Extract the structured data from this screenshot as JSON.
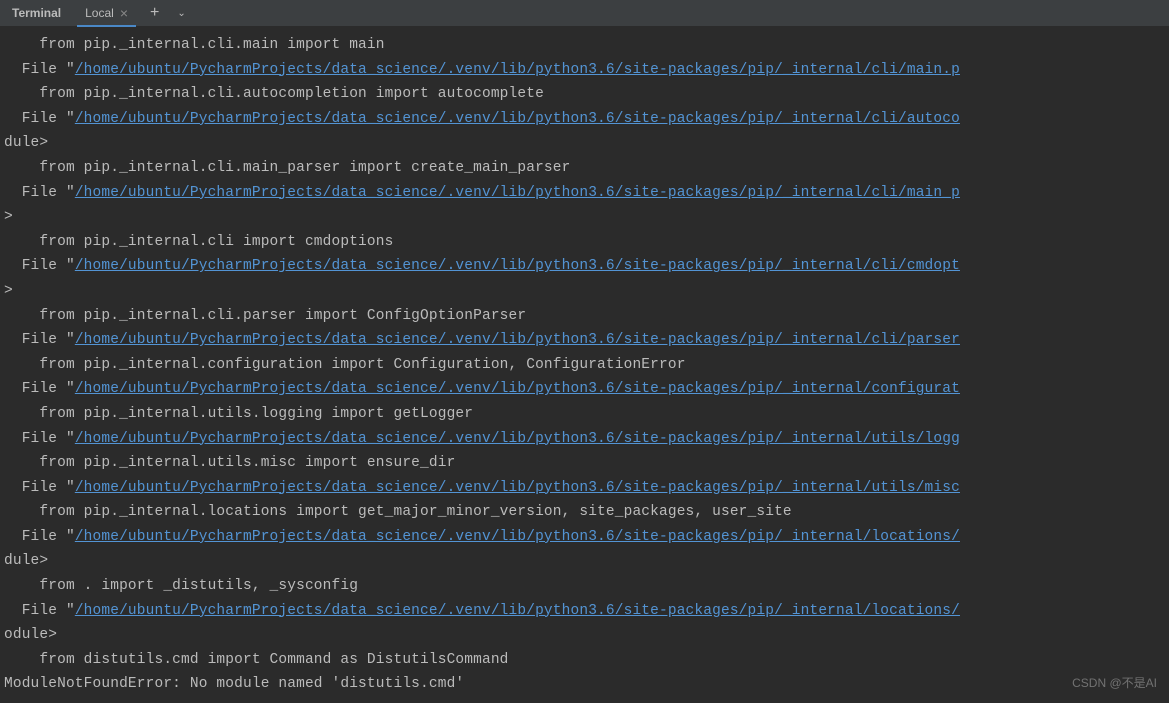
{
  "header": {
    "title": "Terminal",
    "tab_label": "Local",
    "tab_close": "×",
    "add": "+",
    "dropdown": "⌄"
  },
  "lines": [
    {
      "indent": "    ",
      "text": "from pip._internal.cli.main import main"
    },
    {
      "indent": "  ",
      "prefix": "File \"",
      "link": "/home/ubuntu/PycharmProjects/data_science/.venv/lib/python3.6/site-packages/pip/_internal/cli/main.p"
    },
    {
      "indent": "    ",
      "text": "from pip._internal.cli.autocompletion import autocomplete"
    },
    {
      "indent": "  ",
      "prefix": "File \"",
      "link": "/home/ubuntu/PycharmProjects/data_science/.venv/lib/python3.6/site-packages/pip/_internal/cli/autoco"
    },
    {
      "indent": "",
      "text": "dule>"
    },
    {
      "indent": "    ",
      "text": "from pip._internal.cli.main_parser import create_main_parser"
    },
    {
      "indent": "  ",
      "prefix": "File \"",
      "link": "/home/ubuntu/PycharmProjects/data_science/.venv/lib/python3.6/site-packages/pip/_internal/cli/main_p"
    },
    {
      "indent": "",
      "text": ">"
    },
    {
      "indent": "    ",
      "text": "from pip._internal.cli import cmdoptions"
    },
    {
      "indent": "  ",
      "prefix": "File \"",
      "link": "/home/ubuntu/PycharmProjects/data_science/.venv/lib/python3.6/site-packages/pip/_internal/cli/cmdopt"
    },
    {
      "indent": "",
      "text": ">"
    },
    {
      "indent": "    ",
      "text": "from pip._internal.cli.parser import ConfigOptionParser"
    },
    {
      "indent": "  ",
      "prefix": "File \"",
      "link": "/home/ubuntu/PycharmProjects/data_science/.venv/lib/python3.6/site-packages/pip/_internal/cli/parser"
    },
    {
      "indent": "    ",
      "text": "from pip._internal.configuration import Configuration, ConfigurationError"
    },
    {
      "indent": "  ",
      "prefix": "File \"",
      "link": "/home/ubuntu/PycharmProjects/data_science/.venv/lib/python3.6/site-packages/pip/_internal/configurat"
    },
    {
      "indent": "    ",
      "text": "from pip._internal.utils.logging import getLogger"
    },
    {
      "indent": "  ",
      "prefix": "File \"",
      "link": "/home/ubuntu/PycharmProjects/data_science/.venv/lib/python3.6/site-packages/pip/_internal/utils/logg"
    },
    {
      "indent": "    ",
      "text": "from pip._internal.utils.misc import ensure_dir"
    },
    {
      "indent": "  ",
      "prefix": "File \"",
      "link": "/home/ubuntu/PycharmProjects/data_science/.venv/lib/python3.6/site-packages/pip/_internal/utils/misc"
    },
    {
      "indent": "    ",
      "text": "from pip._internal.locations import get_major_minor_version, site_packages, user_site"
    },
    {
      "indent": "  ",
      "prefix": "File \"",
      "link": "/home/ubuntu/PycharmProjects/data_science/.venv/lib/python3.6/site-packages/pip/_internal/locations/"
    },
    {
      "indent": "",
      "text": "dule>"
    },
    {
      "indent": "    ",
      "text": "from . import _distutils, _sysconfig"
    },
    {
      "indent": "  ",
      "prefix": "File \"",
      "link": "/home/ubuntu/PycharmProjects/data_science/.venv/lib/python3.6/site-packages/pip/_internal/locations/"
    },
    {
      "indent": "",
      "text": "odule>"
    },
    {
      "indent": "    ",
      "text": "from distutils.cmd import Command as DistutilsCommand"
    },
    {
      "indent": "",
      "text": "ModuleNotFoundError: No module named 'distutils.cmd'"
    }
  ],
  "watermark": "CSDN @不是AI"
}
